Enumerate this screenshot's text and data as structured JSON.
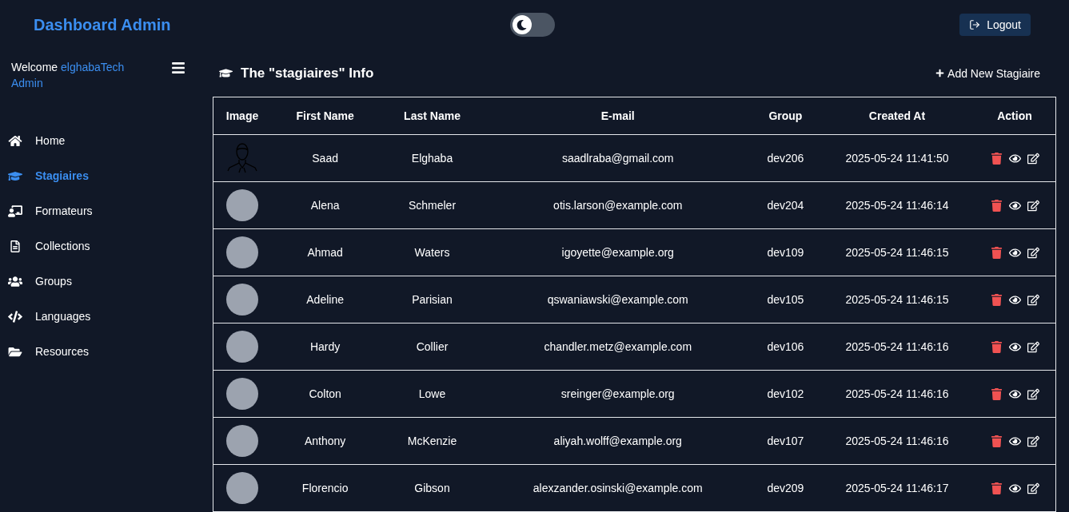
{
  "header": {
    "title": "Dashboard Admin",
    "theme_toggle": {
      "on": false
    },
    "logout": "Logout"
  },
  "sidebar": {
    "welcome": "Welcome",
    "user": "elghabaTech Admin",
    "items": [
      {
        "label": "Home",
        "kind": "home",
        "selected": false
      },
      {
        "label": "Stagiaires",
        "kind": "stagiaires",
        "selected": true
      },
      {
        "label": "Formateurs",
        "kind": "formateurs",
        "selected": false
      },
      {
        "label": "Collections",
        "kind": "collections",
        "selected": false
      },
      {
        "label": "Groups",
        "kind": "groups",
        "selected": false
      },
      {
        "label": "Languages",
        "kind": "languages",
        "selected": false
      },
      {
        "label": "Resources",
        "kind": "resources",
        "selected": false
      }
    ]
  },
  "main": {
    "title": "The \"stagiaires\" Info",
    "add_button": "Add New Stagiaire"
  },
  "table": {
    "columns": [
      "Image",
      "First Name",
      "Last Name",
      "E-mail",
      "Group",
      "Created At",
      "Action"
    ],
    "rows": [
      {
        "kind": "outline",
        "first_name": "Saad",
        "last_name": "Elghaba",
        "email": "saadlraba@gmail.com",
        "group": "dev206",
        "created_at": "2025-05-24 11:41:50"
      },
      {
        "kind": "photo",
        "first_name": "Alena",
        "last_name": "Schmeler",
        "email": "otis.larson@example.com",
        "group": "dev204",
        "created_at": "2025-05-24 11:46:14"
      },
      {
        "kind": "photo",
        "first_name": "Ahmad",
        "last_name": "Waters",
        "email": "igoyette@example.org",
        "group": "dev109",
        "created_at": "2025-05-24 11:46:15"
      },
      {
        "kind": "photo",
        "first_name": "Adeline",
        "last_name": "Parisian",
        "email": "qswaniawski@example.com",
        "group": "dev105",
        "created_at": "2025-05-24 11:46:15"
      },
      {
        "kind": "photo",
        "first_name": "Hardy",
        "last_name": "Collier",
        "email": "chandler.metz@example.com",
        "group": "dev106",
        "created_at": "2025-05-24 11:46:16"
      },
      {
        "kind": "photo",
        "first_name": "Colton",
        "last_name": "Lowe",
        "email": "sreinger@example.org",
        "group": "dev102",
        "created_at": "2025-05-24 11:46:16"
      },
      {
        "kind": "photo",
        "first_name": "Anthony",
        "last_name": "McKenzie",
        "email": "aliyah.wolff@example.org",
        "group": "dev107",
        "created_at": "2025-05-24 11:46:16"
      },
      {
        "kind": "photo",
        "first_name": "Florencio",
        "last_name": "Gibson",
        "email": "alexzander.osinski@example.com",
        "group": "dev209",
        "created_at": "2025-05-24 11:46:17"
      }
    ]
  }
}
